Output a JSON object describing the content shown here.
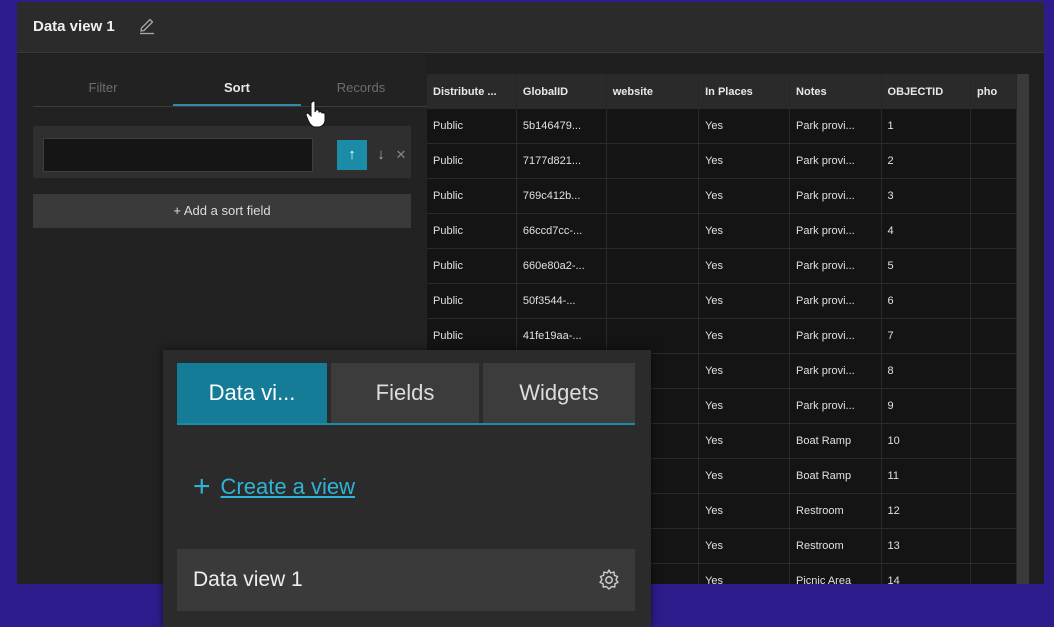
{
  "window": {
    "title": "Data view 1"
  },
  "sidebar": {
    "tabs": [
      "Filter",
      "Sort",
      "Records"
    ],
    "active_tab": "Sort",
    "sort": {
      "field_value": "",
      "add_label": "+ Add a sort field"
    }
  },
  "table": {
    "columns": [
      "Distribute ...",
      "GlobalID",
      "website",
      "In Places",
      "Notes",
      "OBJECTID",
      "pho"
    ],
    "rows": [
      [
        "Public",
        "5b146479...",
        "",
        "Yes",
        "Park provi...",
        "1",
        ""
      ],
      [
        "Public",
        "7177d821...",
        "",
        "Yes",
        "Park provi...",
        "2",
        ""
      ],
      [
        "Public",
        "769c412b...",
        "",
        "Yes",
        "Park provi...",
        "3",
        ""
      ],
      [
        "Public",
        "66ccd7cc-...",
        "",
        "Yes",
        "Park provi...",
        "4",
        ""
      ],
      [
        "Public",
        "660e80a2-...",
        "",
        "Yes",
        "Park provi...",
        "5",
        ""
      ],
      [
        "Public",
        "50f3544-...",
        "",
        "Yes",
        "Park provi...",
        "6",
        ""
      ],
      [
        "Public",
        "41fe19aa-...",
        "",
        "Yes",
        "Park provi...",
        "7",
        ""
      ],
      [
        "",
        "",
        "",
        "Yes",
        "Park provi...",
        "8",
        ""
      ],
      [
        "",
        "",
        "",
        "Yes",
        "Park provi...",
        "9",
        ""
      ],
      [
        "",
        "",
        "",
        "Yes",
        "Boat Ramp",
        "10",
        ""
      ],
      [
        "",
        "",
        "",
        "Yes",
        "Boat Ramp",
        "11",
        ""
      ],
      [
        "",
        "",
        "",
        "Yes",
        "Restroom",
        "12",
        ""
      ],
      [
        "",
        "",
        "",
        "Yes",
        "Restroom",
        "13",
        ""
      ],
      [
        "",
        "",
        "",
        "Yes",
        "Picnic Area",
        "14",
        ""
      ]
    ]
  },
  "overlay": {
    "tabs": [
      "Data vi...",
      "Fields",
      "Widgets"
    ],
    "active_tab": "Data vi...",
    "create_label": "Create a view",
    "views": [
      {
        "label": "Data view 1"
      }
    ]
  },
  "colors": {
    "accent": "#1b8ba8",
    "background": "#2d1d8c",
    "panel": "#222222"
  },
  "icons": [
    "pencil-icon",
    "arrow-up-icon",
    "arrow-down-icon",
    "close-icon",
    "plus-icon",
    "gear-icon",
    "hand-cursor-icon"
  ]
}
